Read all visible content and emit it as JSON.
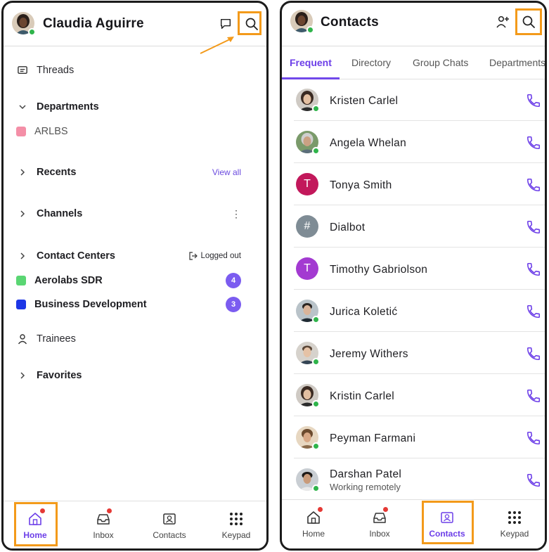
{
  "left": {
    "header": {
      "user_name": "Claudia  Aguirre"
    },
    "sidebar": {
      "threads": "Threads",
      "departments": "Departments",
      "department_items": [
        {
          "label": "ARLBS",
          "color": "#f48fa7"
        }
      ],
      "recents": "Recents",
      "recents_action": "View all",
      "channels": "Channels",
      "channels_menu": "⋮",
      "contact_centers": "Contact Centers",
      "contact_centers_status": "Logged out",
      "contact_center_items": [
        {
          "label": "Aerolabs SDR",
          "color": "#5ad673",
          "count": "4"
        },
        {
          "label": "Business Development",
          "color": "#1d36e6",
          "count": "3"
        }
      ],
      "trainees": "Trainees",
      "favorites": "Favorites"
    },
    "bottom_nav": [
      {
        "label": "Home",
        "icon": "home-icon",
        "active": true
      },
      {
        "label": "Inbox",
        "icon": "inbox-icon"
      },
      {
        "label": "Contacts",
        "icon": "contacts-icon"
      },
      {
        "label": "Keypad",
        "icon": "keypad-icon"
      }
    ]
  },
  "right": {
    "header": {
      "title": "Contacts"
    },
    "tabs": [
      "Frequent",
      "Directory",
      "Group Chats",
      "Departments"
    ],
    "active_tab": "Frequent",
    "contacts": [
      {
        "name": "Kristen Carlel",
        "avatar": "photo",
        "online": true
      },
      {
        "name": "Angela Whelan",
        "avatar": "photo",
        "online": true
      },
      {
        "name": "Tonya Smith",
        "avatar": "T",
        "avatar_color": "#c2185b",
        "online": false
      },
      {
        "name": "Dialbot",
        "avatar": "#",
        "avatar_color": "#7f8c95",
        "online": false
      },
      {
        "name": "Timothy Gabriolson",
        "avatar": "T",
        "avatar_color": "#a33ad1",
        "online": false
      },
      {
        "name": "Jurica Koletić",
        "avatar": "photo",
        "online": true
      },
      {
        "name": "Jeremy Withers",
        "avatar": "photo",
        "online": true
      },
      {
        "name": "Kristin Carlel",
        "avatar": "photo",
        "online": true
      },
      {
        "name": "Peyman Farmani",
        "avatar": "photo",
        "online": true
      },
      {
        "name": "Darshan Patel",
        "status": "Working remotely",
        "avatar": "photo",
        "online": true
      }
    ],
    "bottom_nav": [
      {
        "label": "Home",
        "icon": "home-icon"
      },
      {
        "label": "Inbox",
        "icon": "inbox-icon"
      },
      {
        "label": "Contacts",
        "icon": "contacts-icon",
        "active": true
      },
      {
        "label": "Keypad",
        "icon": "keypad-icon"
      }
    ]
  },
  "colors": {
    "accent": "#6c3ee8",
    "highlight": "#f39a1a",
    "online": "#2fb44b",
    "notification": "#e53935"
  }
}
